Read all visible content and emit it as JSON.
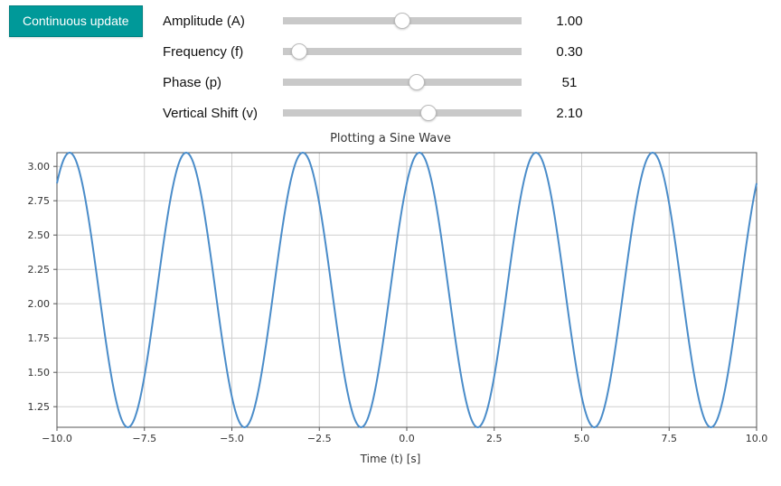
{
  "controls": {
    "toggle_label": "Continuous update",
    "items": [
      {
        "label": "Amplitude (A)",
        "value": "1.00",
        "pos": 0.5
      },
      {
        "label": "Frequency (f)",
        "value": "0.30",
        "pos": 0.07
      },
      {
        "label": "Phase (p)",
        "value": "51",
        "pos": 0.56
      },
      {
        "label": "Vertical Shift (v)",
        "value": "2.10",
        "pos": 0.61
      }
    ]
  },
  "chart_data": {
    "type": "line",
    "title": "Plotting a Sine Wave",
    "xlabel": "Time (t) [s]",
    "ylabel": "",
    "xlim": [
      -10,
      10
    ],
    "ylim": [
      1.1,
      3.1
    ],
    "x_ticks": [
      -10.0,
      -7.5,
      -5.0,
      -2.5,
      0.0,
      2.5,
      5.0,
      7.5,
      10.0
    ],
    "x_tick_labels": [
      "−10.0",
      "−7.5",
      "−5.0",
      "−2.5",
      "0.0",
      "2.5",
      "5.0",
      "7.5",
      "10.0"
    ],
    "y_ticks": [
      1.25,
      1.5,
      1.75,
      2.0,
      2.25,
      2.5,
      2.75,
      3.0
    ],
    "y_tick_labels": [
      "1.25",
      "1.50",
      "1.75",
      "2.00",
      "2.25",
      "2.50",
      "2.75",
      "3.00"
    ],
    "function": {
      "form": "A*sin(2*pi*f*t + p_degrees*pi/180) + v",
      "A": 1.0,
      "f": 0.3,
      "p_degrees": 51,
      "v": 2.1
    }
  }
}
